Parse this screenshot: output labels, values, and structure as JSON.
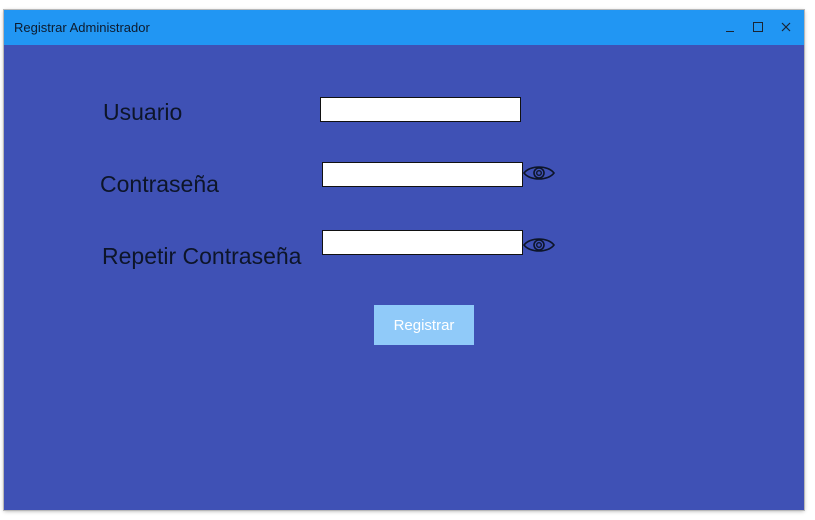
{
  "window": {
    "title": "Registrar Administrador",
    "controls": [
      "minimize-icon",
      "maximize-icon",
      "close-icon"
    ]
  },
  "form": {
    "usuario_label": "Usuario",
    "usuario_value": "",
    "contrasena_label": "Contraseña",
    "contrasena_value": "",
    "repetir_label": "Repetir Contraseña",
    "repetir_value": "",
    "show_password_icon": "eye-icon",
    "submit_label": "Registrar"
  },
  "colors": {
    "titlebar": "#2196f3",
    "background": "#3f51b5",
    "button": "#90caf9"
  }
}
